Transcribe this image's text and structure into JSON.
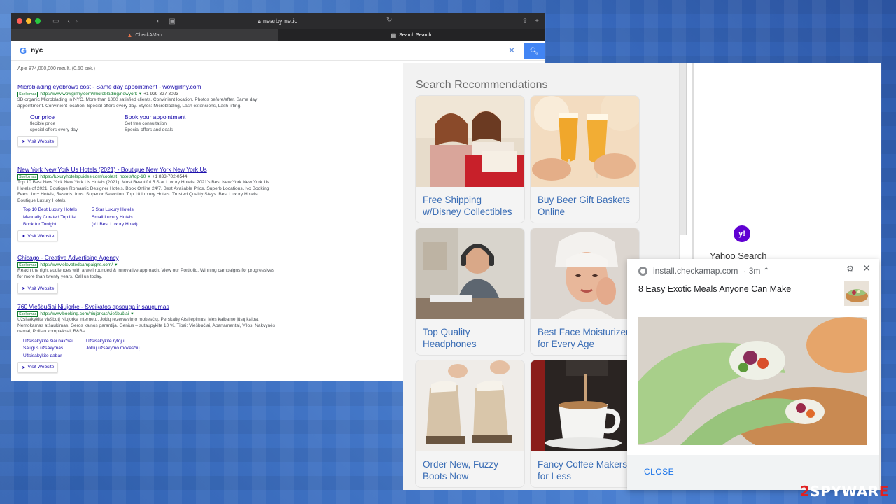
{
  "browser": {
    "url": "nearbyme.io",
    "tabs": [
      {
        "label": "CheckAMap",
        "active": false
      },
      {
        "label": "Search Search",
        "active": true
      }
    ],
    "colors": {
      "red": "#ff5f57",
      "yellow": "#febc2e",
      "green": "#28c840"
    }
  },
  "google": {
    "logo": "G",
    "query": "nyc",
    "results_count": "Apie 874,000,000 rezult. (0.50 sek.)"
  },
  "results": [
    {
      "title": "Microblading eyebrows cost - Same day appointment - wowgirlny.com",
      "badge": "Skelbimas",
      "url": "http://www.wowgirlny.com/microblading/newyork",
      "phone": "+1 929-327-3023",
      "desc": "3D organic Microblading in NYC. More than 1000 satisfied clients. Convinient location. Photos before/after. Same day appointment. Convinient location. Special offers every day. Styles: Microblading, Lash extensions, Lash lifting.",
      "sitelinks": [
        {
          "title": "Our price",
          "lines": [
            "flexible price",
            "special offers every day"
          ]
        },
        {
          "title": "Book your appointment",
          "lines": [
            "Get free consultation",
            "Special offers and deals"
          ]
        }
      ],
      "visit": "Visit Website"
    },
    {
      "title": "New York New York Us Hotels (2021) - Boutique New York New York Us",
      "badge": "Skelbimas",
      "url": "https://luxuryhotelsguides.com/coolest_hotels/top-10",
      "phone": "+1 833-702-0544",
      "desc": "Top 10 Best New York New York Us Hotels (2021). Most Beautiful 5 Star Luxury Hotels. 2021's Best New York New York Us Hotels of 2021. Boutique Romantic Designer Hotels. Book Online 24/7. Best Available Price. Superb Locations. No Booking Fees. 1m+ Hotels, Resorts, Inns. Superior Selection. Top 10 Luxury Hotels. Trusted Quality Stays. Best Luxury Hotels. Boutique Luxury Hotels.",
      "links": [
        "Top 10 Best Luxury Hotels",
        "5 Star Luxury Hotels",
        "Manually Curated Top List",
        "Small Luxury Hotels",
        "Book for Tonight",
        "(#1 Best Luxury Hotel)"
      ],
      "visit": "Visit Website"
    },
    {
      "title": "Chicago - Creative Advertising Agency",
      "badge": "Skelbimas",
      "url": "http://www.elevatedcampaigns.com/",
      "desc": "Reach the right audiences with a well rounded & innovative approach. View our Portfolio. Winning campaigns for progressives for more than twenty years. Call us today.",
      "visit": "Visit Website"
    },
    {
      "title": "760 Viešbučiai Niujorke - Sveikatos apsauga ir saugumas",
      "badge": "Skelbimas",
      "url": "http://www.booking.com/niujorkas/viešbučiai",
      "desc": "Užsisakykite viešbutį Niujorke internetu. Jokių rezervavimo mokesčių. Perskaitę Atsiliepimus. Mes kalbame jūsų kalba. Nemokamas atšaukimas. Geros kainos garantija. Genius – sutaupykite 10 %. Tipai: Viešbučiai, Apartamentai, Vilos, Nakvynės namai, Poilsio kompleksai, B&Bs.",
      "links": [
        "Užsisakykite šiai nakčiai",
        "Užsisakykite rytojui",
        "Saugus užsakymas",
        "Jokių užsakymo mokesčių",
        "Užsisakykite dabar"
      ],
      "visit": "Visit Website"
    }
  ],
  "recommendations": {
    "title": "Search Recommendations",
    "cards": [
      {
        "label": "Free Shipping w/Disney Collectibles"
      },
      {
        "label": "Buy Beer Gift Baskets Online"
      },
      {
        "label": "Top Quality Headphones"
      },
      {
        "label": "Best Face Moisturizer for Every Age"
      },
      {
        "label": "Order New, Fuzzy Boots Now"
      },
      {
        "label": "Fancy Coffee Makers for Less"
      }
    ],
    "link_color": "#3a6db5"
  },
  "yahoo": {
    "logo": "y!",
    "text": "Yahoo Search",
    "brand_color": "#6001d2"
  },
  "notification": {
    "source": "install.checkamap.com",
    "time": "· 3m ⌃",
    "title": "8 Easy Exotic Meals Anyone Can Make",
    "close": "CLOSE"
  },
  "watermark": {
    "prefix": "2",
    "text": "SPYWAR",
    "suffix": "E"
  }
}
